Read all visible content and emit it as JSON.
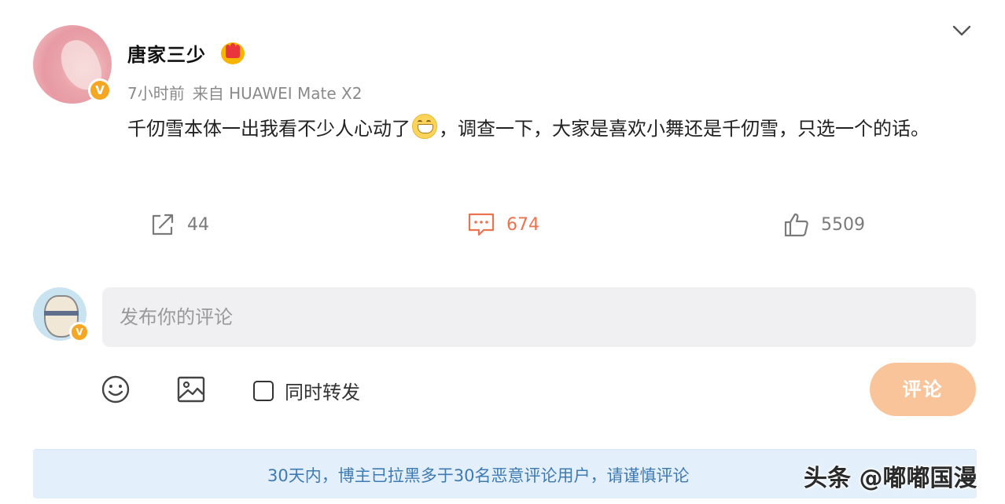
{
  "post": {
    "username": "唐家三少",
    "time": "7小时前",
    "source": "来自 HUAWEI Mate X2",
    "text_part1": "千仞雪本体一出我看不少人心动了",
    "text_part2": "，调查一下，大家是喜欢小舞还是千仞雪，只选一个的话。",
    "badge_icon": "crown-vip-icon",
    "verified_icon": "verified-v-icon"
  },
  "actions": {
    "share_count": "44",
    "comment_count": "674",
    "like_count": "5509"
  },
  "composer": {
    "placeholder": "发布你的评论",
    "repost_label": "同时转发",
    "submit_label": "评论"
  },
  "notice": {
    "text": "30天内，博主已拉黑多于30名恶意评论用户，请谨慎评论"
  },
  "watermark": {
    "text": "头条 @嘟嘟国漫"
  },
  "colors": {
    "accent": "#eb7350",
    "submit_bg": "#f9c49a",
    "notice_bg": "#e3f0fb",
    "notice_text": "#3f7ab2",
    "verified": "#f5a623"
  }
}
